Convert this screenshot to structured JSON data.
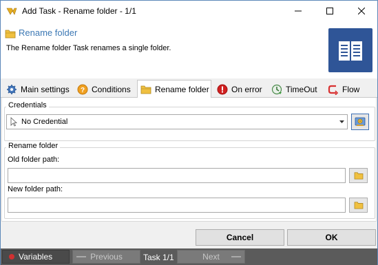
{
  "window": {
    "title": "Add Task - Rename folder - 1/1"
  },
  "header": {
    "title": "Rename folder",
    "description": "The Rename folder Task renames a single folder."
  },
  "tabs": [
    {
      "label": "Main settings",
      "icon": "gear-icon"
    },
    {
      "label": "Conditions",
      "icon": "help-circle-icon"
    },
    {
      "label": "Rename folder",
      "icon": "folder-icon",
      "active": true
    },
    {
      "label": "On error",
      "icon": "error-icon"
    },
    {
      "label": "TimeOut",
      "icon": "timeout-icon"
    },
    {
      "label": "Flow",
      "icon": "flow-icon"
    }
  ],
  "credentials": {
    "group_label": "Credentials",
    "selected": "No Credential"
  },
  "rename": {
    "group_label": "Rename folder",
    "old_label": "Old folder path:",
    "old_value": "",
    "new_label": "New folder path:",
    "new_value": ""
  },
  "buttons": {
    "cancel": "Cancel",
    "ok": "OK"
  },
  "statusbar": {
    "variables": "Variables",
    "previous": "Previous",
    "task": "Task 1/1",
    "next": "Next"
  },
  "colors": {
    "accent": "#3c78b4",
    "task_icon_bg": "#2f5597",
    "statusbar_bg": "#5b5b5b"
  }
}
